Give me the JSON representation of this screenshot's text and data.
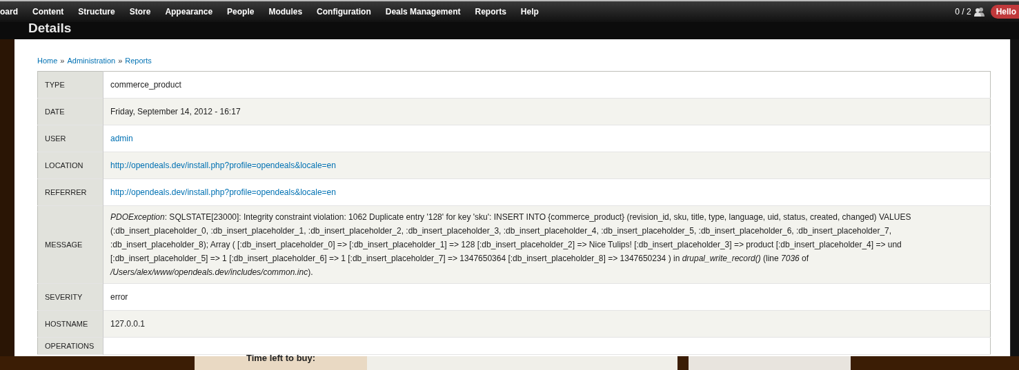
{
  "toolbar": {
    "menu": [
      {
        "label": "oard"
      },
      {
        "label": "Content"
      },
      {
        "label": "Structure"
      },
      {
        "label": "Store"
      },
      {
        "label": "Appearance"
      },
      {
        "label": "People"
      },
      {
        "label": "Modules"
      },
      {
        "label": "Configuration"
      },
      {
        "label": "Deals Management"
      },
      {
        "label": "Reports"
      },
      {
        "label": "Help"
      }
    ],
    "users_count": "0 / 2",
    "hello": "Hello"
  },
  "page_title": "Details",
  "breadcrumb": [
    "Home",
    "Administration",
    "Reports"
  ],
  "breadcrumb_separator": "»",
  "details": [
    {
      "label": "TYPE",
      "value": "commerce_product",
      "kind": "text"
    },
    {
      "label": "DATE",
      "value": "Friday, September 14, 2012 - 16:17",
      "kind": "text"
    },
    {
      "label": "USER",
      "value": "admin",
      "kind": "link"
    },
    {
      "label": "LOCATION",
      "value": "http://opendeals.dev/install.php?profile=opendeals&locale=en",
      "kind": "link"
    },
    {
      "label": "REFERRER",
      "value": "http://opendeals.dev/install.php?profile=opendeals&locale=en",
      "kind": "link"
    },
    {
      "label": "MESSAGE",
      "value": "*PDOException*: SQLSTATE[23000]: Integrity constraint violation: 1062 Duplicate entry '128' for key 'sku': INSERT INTO {commerce_product} (revision_id, sku, title, type, language, uid, status, created, changed) VALUES (:db_insert_placeholder_0, :db_insert_placeholder_1, :db_insert_placeholder_2, :db_insert_placeholder_3, :db_insert_placeholder_4, :db_insert_placeholder_5, :db_insert_placeholder_6, :db_insert_placeholder_7, :db_insert_placeholder_8); Array ( [:db_insert_placeholder_0] => [:db_insert_placeholder_1] => 128 [:db_insert_placeholder_2] => Nice Tulips! [:db_insert_placeholder_3] => product [:db_insert_placeholder_4] => und [:db_insert_placeholder_5] => 1 [:db_insert_placeholder_6] => 1 [:db_insert_placeholder_7] => 1347650364 [:db_insert_placeholder_8] => 1347650234 ) in *drupal_write_record()* (line *7036* of */Users/alex/www/opendeals.dev/includes/common.inc*).",
      "kind": "rich"
    },
    {
      "label": "SEVERITY",
      "value": "error",
      "kind": "text"
    },
    {
      "label": "HOSTNAME",
      "value": "127.0.0.1",
      "kind": "text"
    },
    {
      "label": "OPERATIONS"
    }
  ],
  "background_text": "Time left to buy:"
}
